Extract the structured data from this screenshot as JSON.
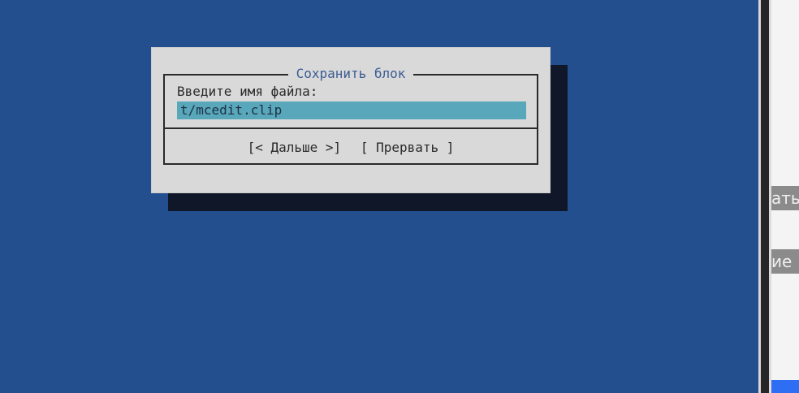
{
  "dialog": {
    "title": "Сохранить блок",
    "prompt": "Введите имя файла:",
    "filename_value": "t/mcedit.clip",
    "buttons": {
      "next": "[< Дальше >]",
      "cancel": "[ Прервать ]"
    }
  },
  "right_peek": {
    "top_text": "ать",
    "bottom_text": "ие"
  },
  "colors": {
    "background": "#244f8f",
    "dialog": "#d9d9d9",
    "input": "#58a7ba",
    "title": "#3b5b93"
  }
}
